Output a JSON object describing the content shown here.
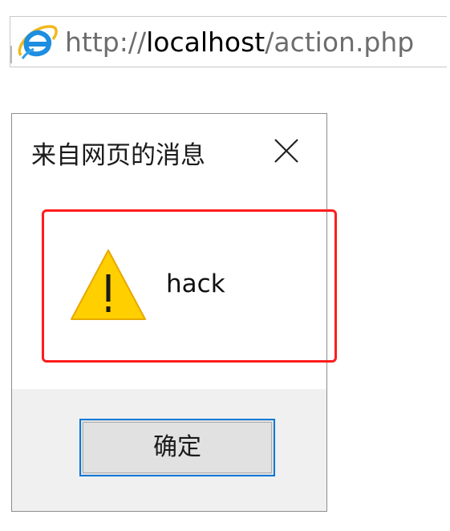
{
  "address_bar": {
    "url_prefix": "http://",
    "url_host": "localhost",
    "url_path": "/action.php",
    "icon": "internet-explorer-icon"
  },
  "dialog": {
    "title": "来自网页的消息",
    "close_icon": "close-icon",
    "message": "hack",
    "warning_icon": "warning-icon",
    "ok_label": "确定"
  },
  "colors": {
    "annotation": "#ff1c1c",
    "ok_button_border": "#0078d7",
    "warning_fill": "#ffcf00",
    "footer_background": "#f0f0f0"
  }
}
